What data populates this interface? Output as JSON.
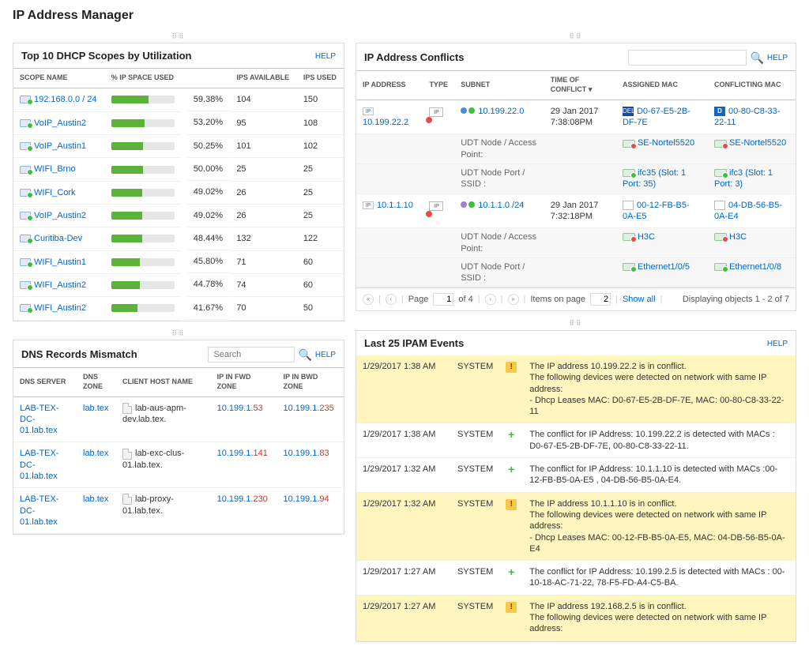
{
  "title": "IP Address Manager",
  "common": {
    "help": "HELP",
    "search_placeholder": "Search"
  },
  "dhcp": {
    "title": "Top 10 DHCP Scopes by Utilization",
    "cols": {
      "name": "SCOPE NAME",
      "used": "% IP SPACE USED",
      "avail": "IPS AVAILABLE",
      "ipsused": "IPS USED"
    },
    "rows": [
      {
        "name": "192.168.0.0 / 24",
        "pct": 59.38,
        "pct_txt": "59.38%",
        "avail": "104",
        "used": "150"
      },
      {
        "name": "VoIP_Austin2",
        "pct": 53.2,
        "pct_txt": "53.20%",
        "avail": "95",
        "used": "108"
      },
      {
        "name": "VoIP_Austin1",
        "pct": 50.25,
        "pct_txt": "50.25%",
        "avail": "101",
        "used": "102"
      },
      {
        "name": "WIFI_Brno",
        "pct": 50.0,
        "pct_txt": "50.00%",
        "avail": "25",
        "used": "25"
      },
      {
        "name": "WIFI_Cork",
        "pct": 49.02,
        "pct_txt": "49.02%",
        "avail": "26",
        "used": "25"
      },
      {
        "name": "VoIP_Austin2",
        "pct": 49.02,
        "pct_txt": "49.02%",
        "avail": "26",
        "used": "25"
      },
      {
        "name": "Curitiba-Dev",
        "pct": 48.44,
        "pct_txt": "48.44%",
        "avail": "132",
        "used": "122"
      },
      {
        "name": "WIFI_Austin1",
        "pct": 45.8,
        "pct_txt": "45.80%",
        "avail": "71",
        "used": "60"
      },
      {
        "name": "WIFI_Austin2",
        "pct": 44.78,
        "pct_txt": "44.78%",
        "avail": "74",
        "used": "60"
      },
      {
        "name": "WIFI_Austin2",
        "pct": 41.67,
        "pct_txt": "41.67%",
        "avail": "70",
        "used": "50"
      }
    ]
  },
  "dns": {
    "title": "DNS Records Mismatch",
    "cols": {
      "server": "DNS SERVER",
      "zone": "DNS ZONE",
      "host": "CLIENT HOST NAME",
      "fwd": "IP IN FWD ZONE",
      "bwd": "IP IN BWD ZONE"
    },
    "rows": [
      {
        "server": "LAB-TEX-DC-01.lab.tex",
        "zone": "lab.tex",
        "host": "lab-aus-apm-dev.lab.tex.",
        "fwd_pre": "10.199.1.",
        "fwd_suf": "53",
        "bwd_pre": "10.199.1.",
        "bwd_suf": "235"
      },
      {
        "server": "LAB-TEX-DC-01.lab.tex",
        "zone": "lab.tex",
        "host": "lab-exc-clus-01.lab.tex.",
        "fwd_pre": "10.199.1.",
        "fwd_suf": "141",
        "bwd_pre": "10.199.1.",
        "bwd_suf": "83"
      },
      {
        "server": "LAB-TEX-DC-01.lab.tex",
        "zone": "lab.tex",
        "host": "lab-proxy-01.lab.tex.",
        "fwd_pre": "10.199.1.",
        "fwd_suf": "230",
        "bwd_pre": "10.199.1.",
        "bwd_suf": "94"
      }
    ]
  },
  "conflicts": {
    "title": "IP Address Conflicts",
    "cols": {
      "ip": "IP ADDRESS",
      "type": "TYPE",
      "subnet": "SUBNET",
      "time": "TIME OF CONFLICT",
      "assigned": "ASSIGNED MAC",
      "conflicting": "CONFLICTING MAC"
    },
    "sub_labels": {
      "ap": "UDT Node / Access Point:",
      "port": "UDT Node Port / SSID :"
    },
    "rows": [
      {
        "ip": "10.199.22.2",
        "subnet": "10.199.22.0",
        "time1": "29 Jan 2017",
        "time2": "7:38:08PM",
        "a_mac": "D0-67-E5-2B-DF-7E",
        "a_dev": "SE-Nortel5520",
        "a_port": "ifc35 (Slot: 1 Port: 35)",
        "c_mac": "00-80-C8-33-22-11",
        "c_dev": "SE-Nortel5520",
        "c_port": "ifc3 (Slot: 1 Port: 3)",
        "a_vendor": "DELL",
        "c_vendor": "D"
      },
      {
        "ip": "10.1.1.10",
        "subnet": "10.1.1.0 /24",
        "time1": "29 Jan 2017",
        "time2": "7:32:18PM",
        "a_mac": "00-12-FB-B5-0A-E5",
        "a_dev": "H3C",
        "a_port": "Ethernet1/0/5",
        "c_mac": "04-DB-56-B5-0A-E4",
        "c_dev": "H3C",
        "c_port": "Ethernet1/0/8",
        "a_vendor": "",
        "c_vendor": ""
      }
    ],
    "pager": {
      "page_lbl": "Page",
      "page_val": "1",
      "of_txt": "of 4",
      "items_lbl": "Items on page",
      "items_val": "2",
      "showall": "Show all",
      "status": "Displaying objects 1 - 2 of 7"
    }
  },
  "events": {
    "title": "Last 25 IPAM Events",
    "source": "SYSTEM",
    "rows": [
      {
        "hl": true,
        "time": "1/29/2017 1:38 AM",
        "kind": "warn",
        "line1": "The IP address 10.199.22.2 is in conflict.",
        "line2": "The following devices were detected on network with same IP address:",
        "line3": "- Dhcp Leases MAC: D0-67-E5-2B-DF-7E, MAC: 00-80-C8-33-22-11"
      },
      {
        "hl": false,
        "time": "1/29/2017 1:38 AM",
        "kind": "ok",
        "line1": "The conflict for IP Address: 10.199.22.2 is detected with MACs : D0-67-E5-2B-DF-7E, 00-80-C8-33-22-11."
      },
      {
        "hl": false,
        "time": "1/29/2017 1:32 AM",
        "kind": "ok",
        "line1": "The conflict for IP Address: 10.1.1.10 is detected with MACs :00-12-FB-B5-0A-E5 , 04-DB-56-B5-0A-E4."
      },
      {
        "hl": true,
        "time": "1/29/2017 1:32 AM",
        "kind": "warn",
        "line1": "The IP address 10.1.1.10 is in conflict.",
        "line2": "The following devices were detected on network with same IP address:",
        "line3": "- Dhcp Leases MAC: 00-12-FB-B5-0A-E5, MAC: 04-DB-56-B5-0A-E4"
      },
      {
        "hl": false,
        "time": "1/29/2017 1:27 AM",
        "kind": "ok",
        "line1": "The conflict for IP Address: 10.199.2.5 is detected with MACs : 00-10-18-AC-71-22, 78-F5-FD-A4-C5-BA."
      },
      {
        "hl": true,
        "time": "1/29/2017 1:27 AM",
        "kind": "warn",
        "line1": "The IP address 192.168.2.5 is in conflict.",
        "line2": "The following devices were detected on network with same IP address:"
      }
    ]
  }
}
